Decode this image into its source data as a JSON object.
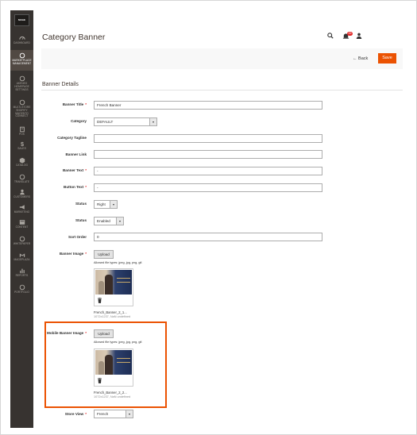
{
  "sidebar": {
    "logo": "MAGE",
    "items": [
      {
        "label": "Dashboard",
        "icon": "dashboard-icon"
      },
      {
        "label": "Marketplace Management",
        "icon": "marketplace-icon",
        "active": true
      },
      {
        "label": "Akeneo Homepage Settings",
        "icon": "circle-icon"
      },
      {
        "label": "Multi-store Shopify Magento Connect",
        "icon": "circle-icon"
      },
      {
        "label": "POS",
        "icon": "pos-icon"
      },
      {
        "label": "Sales",
        "icon": "dollar-icon"
      },
      {
        "label": "Catalog",
        "icon": "catalog-icon"
      },
      {
        "label": "Translate",
        "icon": "circle-icon"
      },
      {
        "label": "Customers",
        "icon": "customers-icon"
      },
      {
        "label": "Marketing",
        "icon": "megaphone-icon"
      },
      {
        "label": "Content",
        "icon": "content-icon"
      },
      {
        "label": "Whitepaper",
        "icon": "circle-icon"
      },
      {
        "label": "Mageplaza",
        "icon": "mageplaza-icon"
      },
      {
        "label": "Reports",
        "icon": "reports-icon"
      },
      {
        "label": "Portfolio",
        "icon": "circle-icon"
      }
    ]
  },
  "header": {
    "title": "Category Banner",
    "notification_count": "99"
  },
  "actions": {
    "back_label": "Back",
    "save_label": "Save"
  },
  "section": {
    "title": "Banner Details"
  },
  "form": {
    "banner_title": {
      "label": "Banner Title",
      "value": "French Banner",
      "required": true
    },
    "category": {
      "label": "Category",
      "value": "DEFAULT"
    },
    "category_tagline": {
      "label": "Category Tagline",
      "value": ""
    },
    "banner_link": {
      "label": "Banner Link",
      "value": ""
    },
    "banner_text": {
      "label": "Banner Text",
      "value": "-",
      "required": true
    },
    "button_text": {
      "label": "Button Text",
      "value": "-",
      "required": true
    },
    "status_position": {
      "label": "Status",
      "value": "Right"
    },
    "status": {
      "label": "Status",
      "value": "Enabled"
    },
    "sort_order": {
      "label": "Sort Order",
      "value": "0"
    },
    "banner_image": {
      "label": "Banner Image",
      "required": true,
      "upload_label": "Upload",
      "note": "Allowed file types: jpeg, jpg, png, gif.",
      "file_name": "French_Banner_2_1...",
      "file_dims": "1072x1237, NaN undefined"
    },
    "mobile_banner_image": {
      "label": "Mobile Banner Image",
      "required": true,
      "upload_label": "Upload",
      "note": "Allowed file types: jpeg, jpg, png, gif.",
      "file_name": "French_Banner_2_2...",
      "file_dims": "1072x1237, NaN undefined"
    },
    "store_view": {
      "label": "Store View",
      "value": "French",
      "required": true
    }
  },
  "colors": {
    "accent": "#eb5202",
    "sidebar_bg": "#373330",
    "required": "#e22626"
  }
}
